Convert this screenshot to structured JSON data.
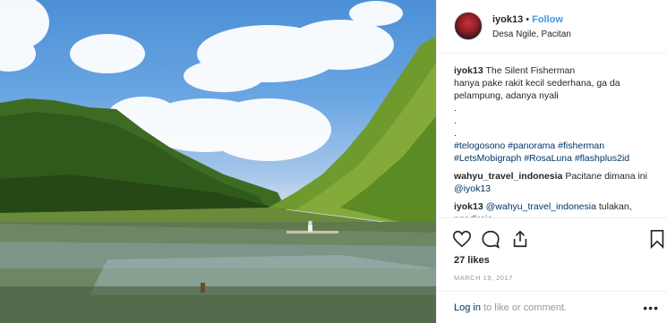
{
  "post": {
    "username": "iyok13",
    "follow_label": "Follow",
    "separator": "•",
    "location": "Desa Ngile, Pacitan"
  },
  "caption": {
    "user": "iyok13",
    "title": "The Silent Fisherman",
    "body": "hanya pake rakit kecil sederhana, ga da pelampung, adanya nyali",
    "dots": [
      ".",
      ".",
      "."
    ],
    "hashtags_line1": "#telogosono #panorama #fisherman",
    "hashtags_line2": "#LetsMobigraph #RosaLuna #flashplus2id"
  },
  "comments": [
    {
      "user": "wahyu_travel_indonesia",
      "text": "Pacitane dimana ini ",
      "mention": "@iyok13"
    },
    {
      "user": "iyok13",
      "mention": "@wahyu_travel_indonesia",
      "text": " tulakan,",
      "partial": "ngadirojo"
    }
  ],
  "actions": {
    "likes": "27 likes",
    "date": "MARCH 19, 2017",
    "icons": [
      "heart-icon",
      "comment-icon",
      "share-icon",
      "bookmark-icon"
    ]
  },
  "add_comment": {
    "login_label": "Log in",
    "rest_label": " to like or comment.",
    "more_label": "•••"
  }
}
